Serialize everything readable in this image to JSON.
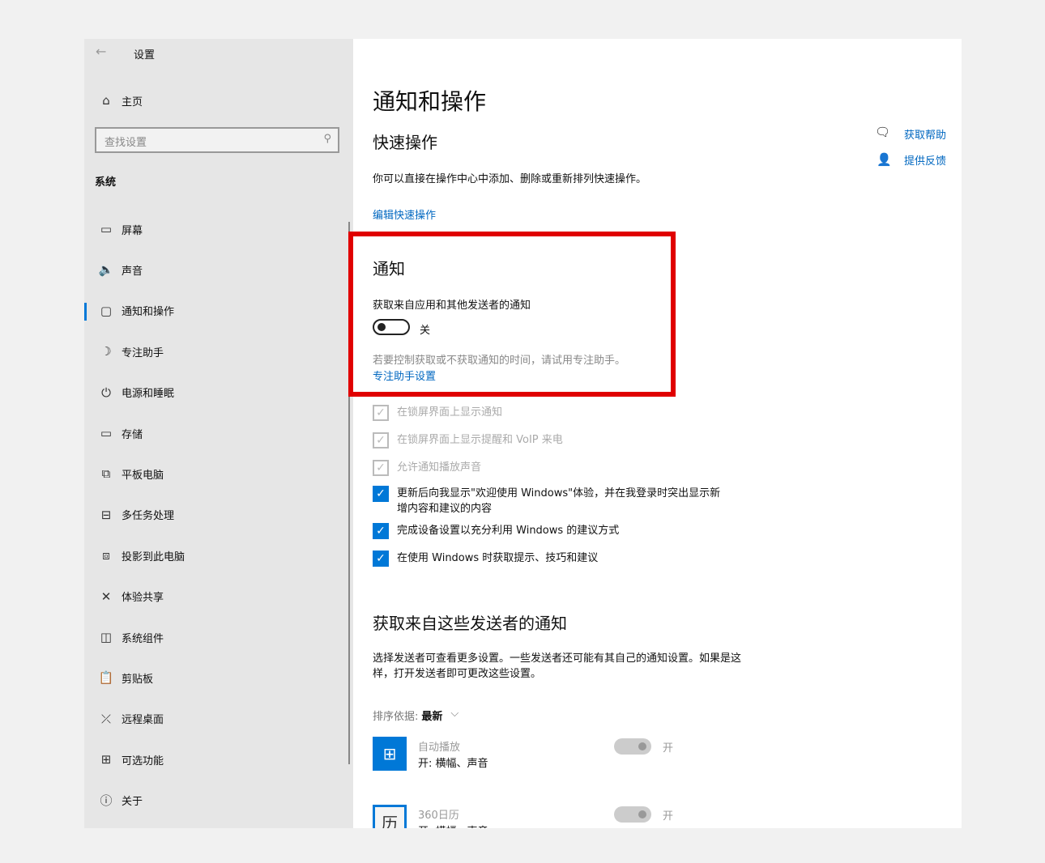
{
  "window": {
    "back_icon": "arrow-left",
    "title": "设置"
  },
  "sidebar": {
    "home": "主页",
    "search_placeholder": "查找设置",
    "section": "系统",
    "items": [
      {
        "icon": "monitor",
        "glyph": "▭",
        "label": "屏幕"
      },
      {
        "icon": "speaker",
        "glyph": "🔈",
        "label": "声音"
      },
      {
        "icon": "message",
        "glyph": "▢",
        "label": "通知和操作",
        "selected": true
      },
      {
        "icon": "moon",
        "glyph": "☽",
        "label": "专注助手"
      },
      {
        "icon": "power",
        "glyph": "⏻",
        "label": "电源和睡眠"
      },
      {
        "icon": "storage",
        "glyph": "▭",
        "label": "存储"
      },
      {
        "icon": "tablet",
        "glyph": "⧉",
        "label": "平板电脑"
      },
      {
        "icon": "multitask",
        "glyph": "⊟",
        "label": "多任务处理"
      },
      {
        "icon": "project",
        "glyph": "⧈",
        "label": "投影到此电脑"
      },
      {
        "icon": "share",
        "glyph": "✕",
        "label": "体验共享"
      },
      {
        "icon": "components",
        "glyph": "◫",
        "label": "系统组件"
      },
      {
        "icon": "clipboard",
        "glyph": "📋",
        "label": "剪贴板"
      },
      {
        "icon": "remote",
        "glyph": "⤫",
        "label": "远程桌面"
      },
      {
        "icon": "features",
        "glyph": "⊞",
        "label": "可选功能"
      },
      {
        "icon": "info",
        "glyph": "ⓘ",
        "label": "关于"
      }
    ]
  },
  "main": {
    "title": "通知和操作",
    "quick_title": "快速操作",
    "quick_desc": "你可以直接在操作中心中添加、删除或重新排列快速操作。",
    "quick_link": "编辑快速操作",
    "help": "获取帮助",
    "feedback": "提供反馈",
    "notif_title": "通知",
    "notif_label": "获取来自应用和其他发送者的通知",
    "toggle_state": "关",
    "focus_desc": "若要控制获取或不获取通知的时间，请试用专注助手。",
    "focus_link": "专注助手设置",
    "checkboxes": [
      {
        "label": "在锁屏界面上显示通知",
        "checked": true,
        "disabled": true
      },
      {
        "label": "在锁屏界面上显示提醒和 VoIP 来电",
        "checked": true,
        "disabled": true
      },
      {
        "label": "允许通知播放声音",
        "checked": true,
        "disabled": true
      },
      {
        "label": "更新后向我显示\"欢迎使用 Windows\"体验，并在我登录时突出显示新增内容和建议的内容",
        "checked": true
      },
      {
        "label": "完成设备设置以充分利用 Windows 的建议方式",
        "checked": true
      },
      {
        "label": "在使用 Windows 时获取提示、技巧和建议",
        "checked": true
      }
    ],
    "senders_title": "获取来自这些发送者的通知",
    "senders_desc": "选择发送者可查看更多设置。一些发送者还可能有其自己的通知设置。如果是这样，打开发送者即可更改这些设置。",
    "sort_label": "排序依据:",
    "sort_value": "最新",
    "apps": [
      {
        "name": "自动播放",
        "sub": "开: 横幅、声音",
        "state": "开"
      },
      {
        "name": "360日历",
        "sub": "开: 横幅、声音",
        "state": "开"
      }
    ]
  },
  "colors": {
    "accent": "#0078d7",
    "highlight": "#e00000"
  }
}
